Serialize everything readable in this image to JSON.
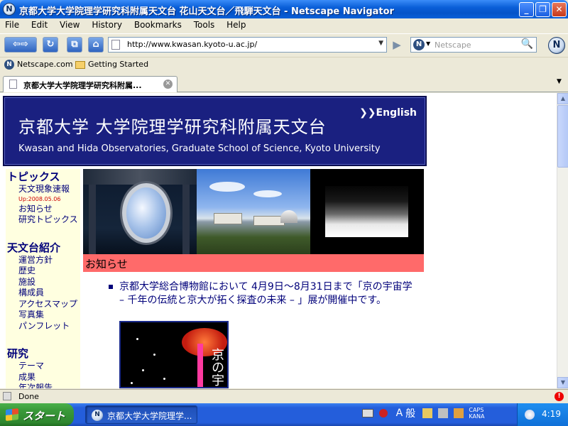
{
  "window": {
    "title": "京都大学大学院理学研究科附属天文台 花山天文台／飛騨天文台 - Netscape Navigator",
    "controls": {
      "minimize": "_",
      "maximize": "❐",
      "close": "✕"
    }
  },
  "menu": [
    "File",
    "Edit",
    "View",
    "History",
    "Bookmarks",
    "Tools",
    "Help"
  ],
  "nav": {
    "url": "http://www.kwasan.kyoto-u.ac.jp/",
    "search_placeholder": "Netscape",
    "icons": [
      "back-icon",
      "forward-icon",
      "reload-icon",
      "new-tab-icon",
      "home-icon",
      "go-icon",
      "search-icon"
    ]
  },
  "bookmarks": [
    "Netscape.com",
    "Getting Started"
  ],
  "tab": {
    "title": "京都大学大学院理学研究科附属..."
  },
  "page": {
    "banner_jp": "京都大学 大学院理学研究科附属天文台",
    "banner_en": "Kwasan and Hida Observatories, Graduate School of Science, Kyoto University",
    "english_link": "❯❯English",
    "sidebar": {
      "topics_heading": "トピックス",
      "topics_items": [
        "天文現象速報",
        "お知らせ",
        "研究トピックス"
      ],
      "update": "Up:2008.05.06",
      "about_heading": "天文台紹介",
      "about_items": [
        "運営方針",
        "歴史",
        "施設",
        "構成員",
        "アクセスマップ",
        "写真集",
        "パンフレット"
      ],
      "research_heading": "研究",
      "research_items": [
        "テーマ",
        "成果",
        "年次報告"
      ]
    },
    "news_heading": "お知らせ",
    "news_item": "京都大学総合博物館において 4月9日〜8月31日まで「京の宇宙学 – 千年の伝統と京大が拓く探査の未来 – 」展が開催中です。",
    "poster_text": "京の宇"
  },
  "status": {
    "text": "Done"
  },
  "taskbar": {
    "start": "スタート",
    "task": "京都大学大学院理学...",
    "ime": [
      "A",
      "般",
      "CAPS",
      "KANA"
    ],
    "clock": "4:19"
  }
}
